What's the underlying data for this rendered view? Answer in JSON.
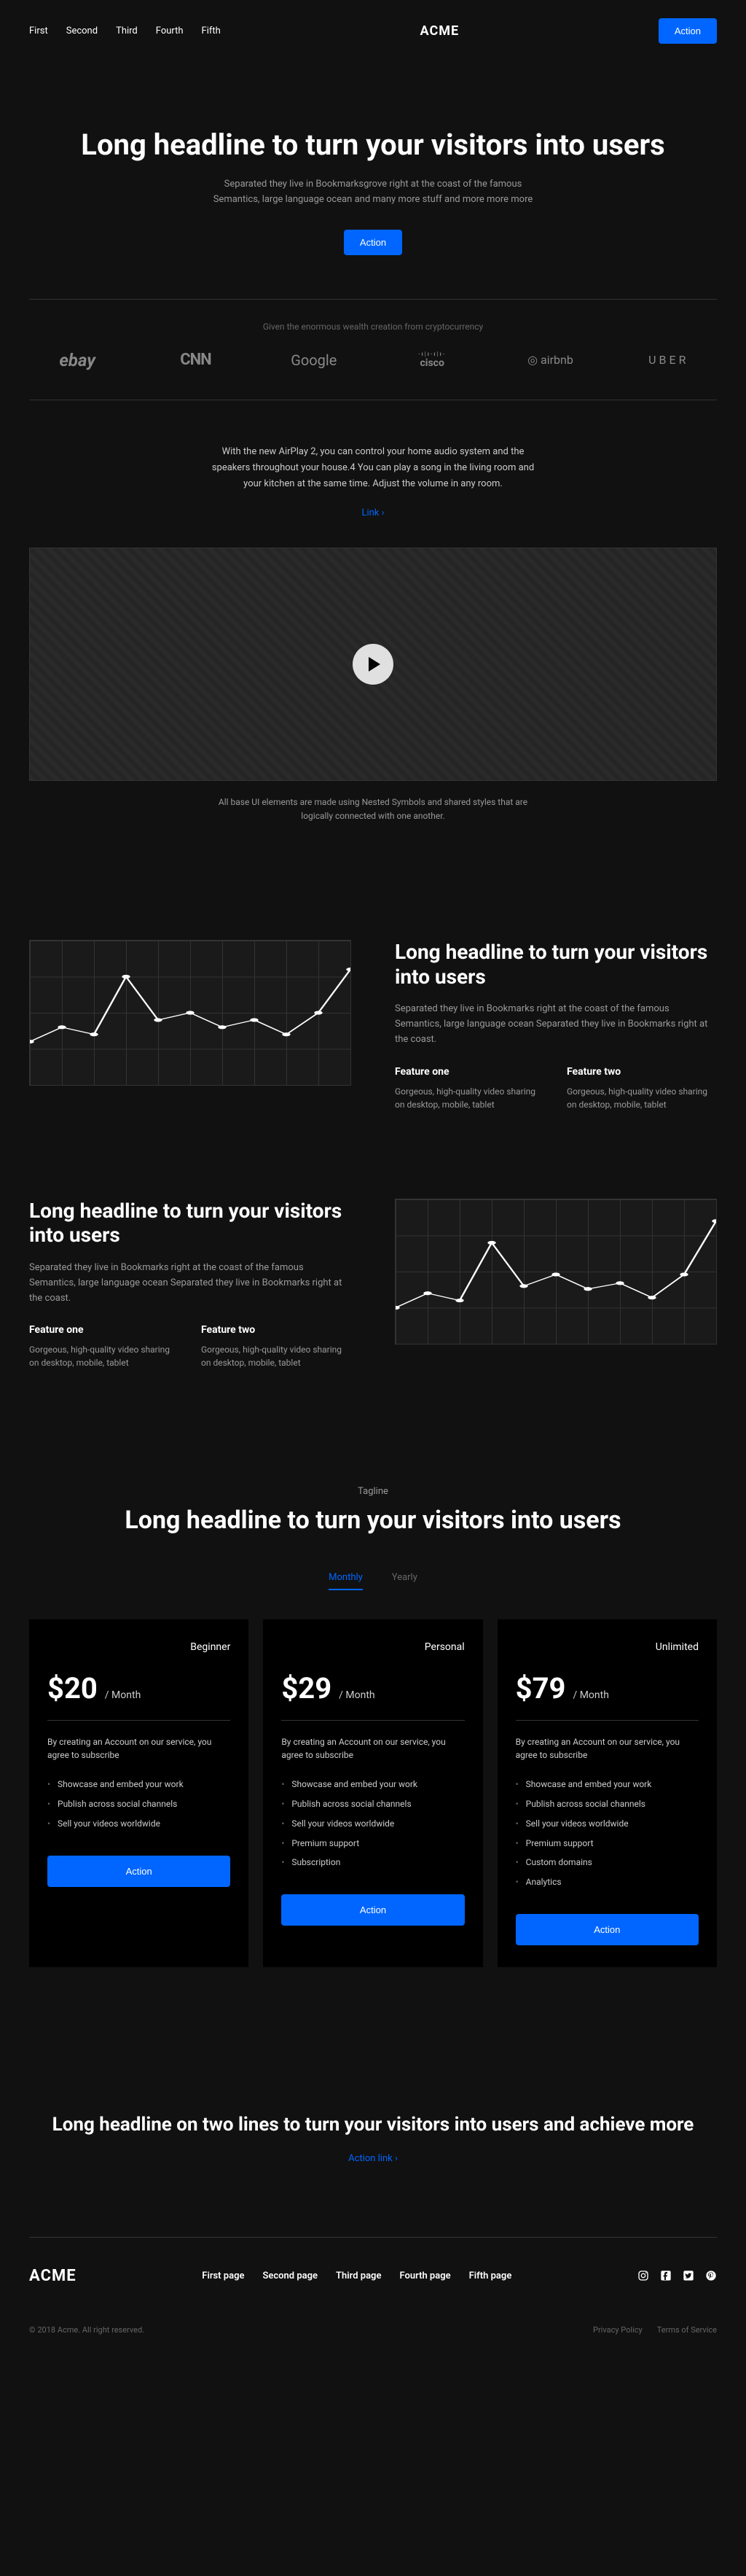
{
  "header": {
    "nav": [
      "First",
      "Second",
      "Third",
      "Fourth",
      "Fifth"
    ],
    "logo": "ACME",
    "cta": "Action"
  },
  "hero": {
    "title": "Long headline to turn your visitors into users",
    "sub": "Separated they live in Bookmarksgrove right at the coast of the famous Semantics, large language ocean and many more stuff and more more more",
    "cta": "Action"
  },
  "logos": {
    "intro": "Given the enormous wealth creation from cryptocurrency",
    "items": [
      "ebay",
      "CNN",
      "Google",
      "cisco",
      "airbnb",
      "UBER"
    ]
  },
  "airplay": {
    "body": "With the new AirPlay 2, you can control your home audio system and the speakers throughout your house.4 You can play a song in the living room and your kitchen at the same time. Adjust the volume in any room.",
    "link": "Link"
  },
  "caption": "All base UI elements are made using Nested Symbols and shared styles that are logically connected with one another.",
  "chart_data": [
    {
      "type": "line",
      "x": [
        0,
        1,
        2,
        3,
        4,
        5,
        6,
        7,
        8,
        9,
        10
      ],
      "values": [
        30,
        40,
        35,
        75,
        45,
        50,
        40,
        45,
        35,
        50,
        80
      ],
      "ylim": [
        0,
        100
      ]
    },
    {
      "type": "line",
      "x": [
        0,
        1,
        2,
        3,
        4,
        5,
        6,
        7,
        8,
        9,
        10
      ],
      "values": [
        25,
        35,
        30,
        70,
        40,
        48,
        38,
        42,
        32,
        48,
        85
      ],
      "ylim": [
        0,
        100
      ]
    }
  ],
  "feature_block": {
    "title": "Long headline to turn your visitors into users",
    "body": "Separated they live in Bookmarks right at the coast of the famous Semantics, large language ocean Separated they live in Bookmarks right at the coast.",
    "features": [
      {
        "title": "Feature one",
        "body": "Gorgeous, high-quality video sharing on desktop, mobile, tablet"
      },
      {
        "title": "Feature two",
        "body": "Gorgeous, high-quality video sharing on desktop, mobile, tablet"
      }
    ]
  },
  "pricing": {
    "tagline": "Tagline",
    "title": "Long headline to turn your visitors into users",
    "tabs": [
      "Monthly",
      "Yearly"
    ],
    "plans": [
      {
        "name": "Beginner",
        "price": "$20",
        "period": "/ Month",
        "desc": "By creating an Account on our service, you agree to subscribe",
        "items": [
          "Showcase and embed your work",
          "Publish across social channels",
          "Sell your videos worldwide"
        ],
        "cta": "Action"
      },
      {
        "name": "Personal",
        "price": "$29",
        "period": "/ Month",
        "desc": "By creating an Account on our service, you agree to subscribe",
        "items": [
          "Showcase and embed your work",
          "Publish across social channels",
          "Sell your videos worldwide",
          "Premium support",
          "Subscription"
        ],
        "cta": "Action"
      },
      {
        "name": "Unlimited",
        "price": "$79",
        "period": "/ Month",
        "desc": "By creating an Account on our service, you agree to subscribe",
        "items": [
          "Showcase and embed your work",
          "Publish across social channels",
          "Sell your videos worldwide",
          "Premium support",
          "Custom domains",
          "Analytics"
        ],
        "cta": "Action"
      }
    ]
  },
  "cta": {
    "title": "Long headline on two lines to turn your visitors into users and achieve more",
    "link": "Action link"
  },
  "footer": {
    "logo": "ACME",
    "nav": [
      "First page",
      "Second page",
      "Third page",
      "Fourth page",
      "Fifth page"
    ],
    "copyright": "© 2018 Acme. All right reserved.",
    "legal": [
      "Privacy Policy",
      "Terms of Service"
    ]
  }
}
